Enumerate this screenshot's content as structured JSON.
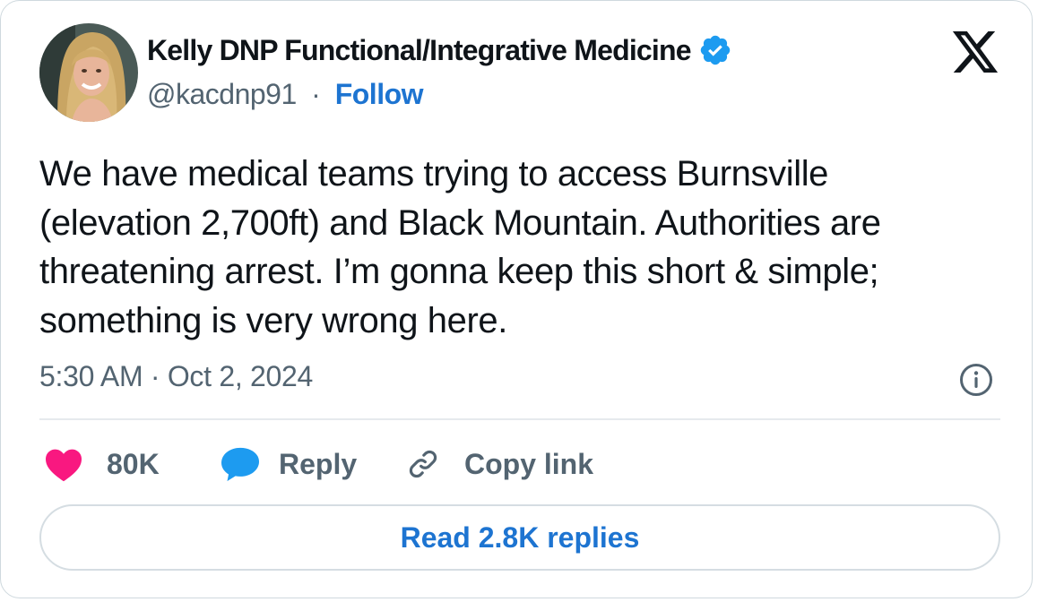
{
  "author": {
    "display_name": "Kelly DNP Functional/Integrative Medicine",
    "handle": "@kacdnp91",
    "separator": "·",
    "follow_label": "Follow"
  },
  "tweet": {
    "text": "We have medical teams trying to access Burnsville (elevation 2,700ft) and Black Mountain. Authorities are threatening arrest. I’m gonna keep this short & simple; something is very wrong here.",
    "timestamp": "5:30 AM · Oct 2, 2024"
  },
  "actions": {
    "likes_count": "80K",
    "reply_label": "Reply",
    "copy_link_label": "Copy link"
  },
  "read_replies_label": "Read 2.8K replies",
  "icons": {
    "verified": "verified-badge-icon",
    "platform": "x-logo-icon",
    "info": "info-icon",
    "like": "heart-icon",
    "reply": "speech-bubble-icon",
    "copy_link": "link-icon"
  },
  "colors": {
    "accent_blue": "#1d74d1",
    "heart": "#f91880",
    "reply_bubble": "#1d9bf0",
    "text_primary": "#0f1419",
    "text_secondary": "#536471"
  }
}
